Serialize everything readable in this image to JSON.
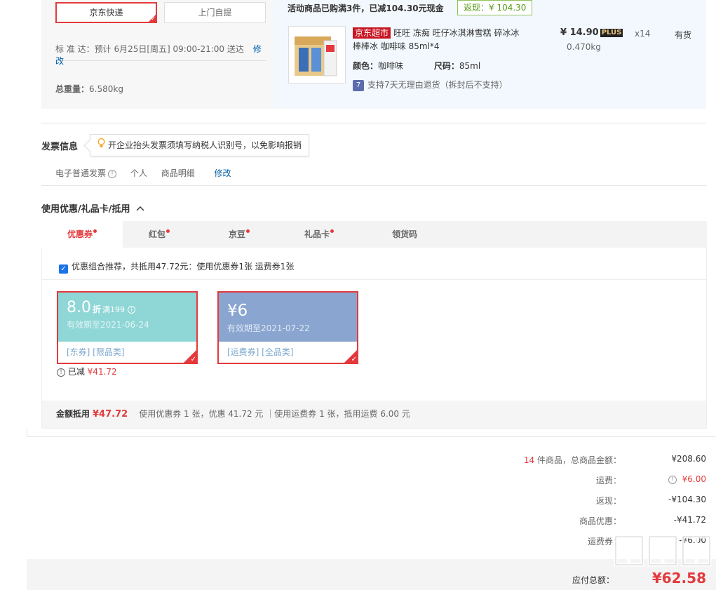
{
  "shipping": {
    "jd_express": "京东快递",
    "self_pickup": "上门自提",
    "delivery_label": "标 准 达：",
    "delivery_estimate": "预计 6月25日[周五] 09:00-21:00 送达",
    "delivery_edit": "修改",
    "weight_label": "总重量：",
    "weight_value": "6.580kg"
  },
  "promo": {
    "title": "活动商品已购满3件，已减104.30元现金",
    "cashback": "返现：¥ 104.30"
  },
  "product": {
    "store_tag": "京东超市",
    "name": "旺旺 冻痴 旺仔冰淇淋雪糕 碎冰冰 棒棒冰 咖啡味 85ml*4",
    "color_label": "颜色：",
    "color_value": "咖啡味",
    "size_label": "尺码：",
    "size_value": "85ml",
    "return_icon": "7",
    "return_text": "支持7天无理由退货（拆封后不支持）",
    "price": "¥ 14.90",
    "plus": "PLUS",
    "weight": "0.470kg",
    "qty": "x14",
    "stock": "有货"
  },
  "invoice": {
    "title": "发票信息",
    "tip": "开企业抬头发票须填写纳税人识别号，以免影响报销",
    "type": "电子普通发票",
    "info_icon": "!",
    "holder": "个人",
    "content": "商品明细",
    "edit": "修改"
  },
  "coupons": {
    "title": "使用优惠/礼品卡/抵用",
    "tabs": [
      "优惠券",
      "红包",
      "京豆",
      "礼品卡",
      "领货码"
    ],
    "combo_check": "✓",
    "combo_text": "优惠组合推荐，共抵用47.72元：使用优惠券1张 运费券1张",
    "items": [
      {
        "amount": "8.0",
        "unit": "折",
        "condition": "满199",
        "expiry": "有效期至2021-06-24",
        "tags": "[东券]  [限品类]"
      },
      {
        "amount": "¥6",
        "expiry": "有效期至2021-07-22",
        "tags": "[运费券]  [全品类]"
      }
    ],
    "reduced_label": "已减",
    "reduced_value": "¥41.72",
    "sum_label": "金额抵用",
    "sum_value": "¥47.72",
    "sum_detail": "使用优惠券 1 张，优惠 41.72 元 ｜使用运费券 1 张，抵用运费 6.00 元"
  },
  "totals": {
    "count": "14",
    "goods_label": "件商品，总商品金额：",
    "goods_value": "¥208.60",
    "freight_label": "运费：",
    "freight_value": "¥6.00",
    "cashback_label": "返现：",
    "cashback_value": "-¥104.30",
    "discount_label": "商品优惠：",
    "discount_value": "-¥41.72",
    "freight_coupon_label": "运费券：",
    "freight_coupon_value": "-¥6.00",
    "payable_label": "应付总额：",
    "payable_value": "¥62.58"
  },
  "colors": {
    "accent": "#e4393c",
    "link": "#005ea7",
    "coupon_discount": "#8fd6d6",
    "coupon_freight": "#89a5d0"
  }
}
